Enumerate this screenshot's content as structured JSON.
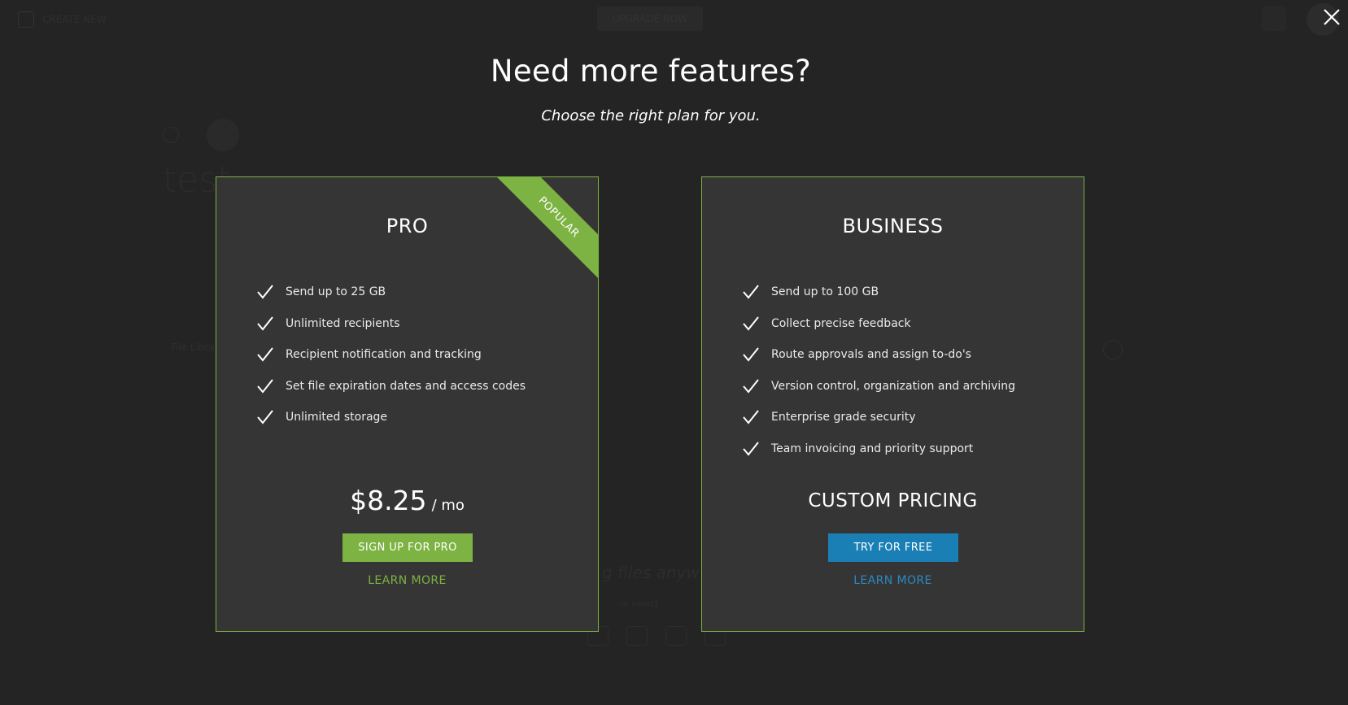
{
  "background": {
    "topbar_left_label": "CREATE NEW",
    "upgrade_label": "UPGRADE NOW",
    "board_title": "test",
    "tab_label": "File Library",
    "drop_text": "g files anyw",
    "drop_sub": "or select"
  },
  "modal": {
    "heading": "Need more features?",
    "subheading": "Choose the right plan for you.",
    "colors": {
      "accent_green": "#7cb342",
      "accent_blue": "#1a7fb5",
      "card_bg": "#353535",
      "overlay_bg": "#242424"
    },
    "plans": {
      "pro": {
        "title": "PRO",
        "ribbon": "POPULAR",
        "features": [
          "Send up to 25 GB",
          "Unlimited recipients",
          "Recipient notification and tracking",
          "Set file expiration dates and access codes",
          "Unlimited storage"
        ],
        "price": "$8.25",
        "per": "/ mo",
        "cta": "SIGN UP FOR PRO",
        "learn_more": "LEARN MORE"
      },
      "business": {
        "title": "BUSINESS",
        "features": [
          "Send up to 100 GB",
          "Collect precise feedback",
          "Route approvals and assign to-do's",
          "Version control, organization and archiving",
          "Enterprise grade security",
          "Team invoicing and priority support"
        ],
        "pricing_label": "CUSTOM PRICING",
        "cta": "TRY FOR FREE",
        "learn_more": "LEARN MORE"
      }
    }
  }
}
